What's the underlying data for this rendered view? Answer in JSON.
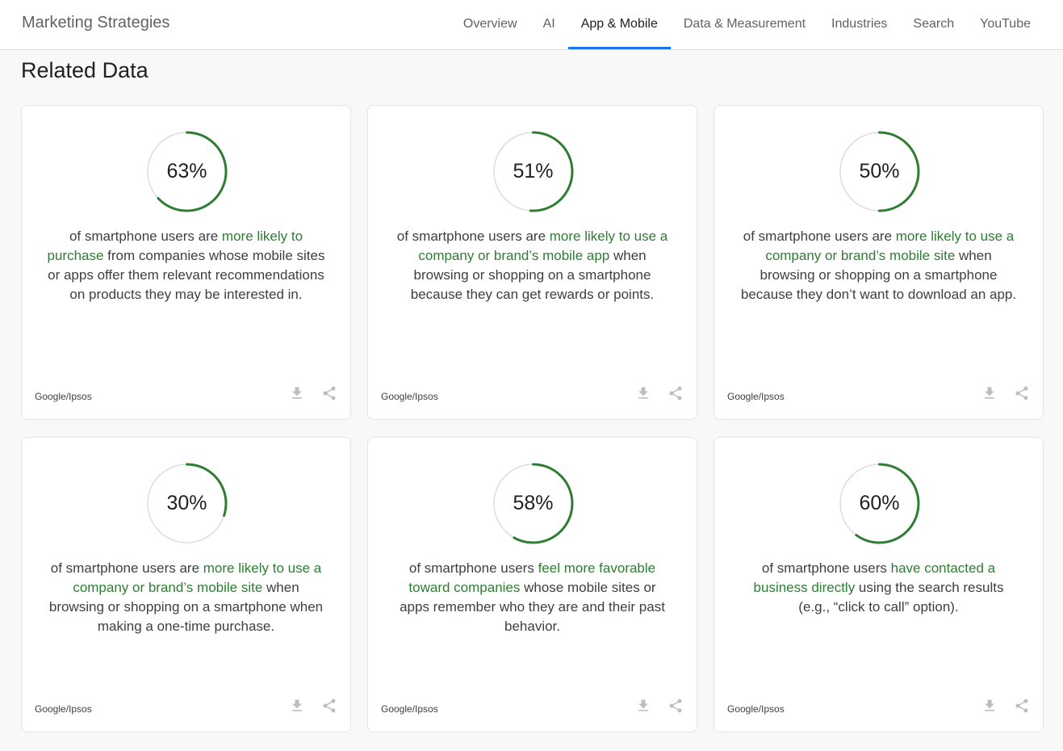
{
  "header": {
    "brand": "Marketing Strategies",
    "nav": [
      {
        "label": "Overview"
      },
      {
        "label": "AI"
      },
      {
        "label": "App & Mobile"
      },
      {
        "label": "Data & Measurement"
      },
      {
        "label": "Industries"
      },
      {
        "label": "Search"
      },
      {
        "label": "YouTube"
      }
    ],
    "active_index": 2
  },
  "section": {
    "title": "Related Data"
  },
  "colors": {
    "accent": "#2e7d32",
    "ring_track": "#dddddd",
    "nav_active": "#1a73e8"
  },
  "cards": [
    {
      "value_label": "63%",
      "fraction": 0.63,
      "text_before": "of smartphone users are ",
      "highlight": "more likely to purchase",
      "text_after": " from companies whose mobile sites or apps offer them relevant recommendations on products they may be interested in.",
      "source": "Google/Ipsos",
      "icons": [
        "download-icon",
        "share-icon"
      ]
    },
    {
      "value_label": "51%",
      "fraction": 0.51,
      "text_before": "of smartphone users are ",
      "highlight": "more likely to use a company or brand’s mobile app",
      "text_after": " when browsing or shopping on a smartphone because they can get rewards or points.",
      "source": "Google/Ipsos",
      "icons": [
        "download-icon",
        "share-icon"
      ]
    },
    {
      "value_label": "50%",
      "fraction": 0.5,
      "text_before": "of smartphone users are ",
      "highlight": "more likely to use a company or brand’s mobile site",
      "text_after": " when browsing or shopping on a smartphone because they don’t want to download an app.",
      "source": "Google/Ipsos",
      "icons": [
        "download-icon",
        "share-icon"
      ]
    },
    {
      "value_label": "30%",
      "fraction": 0.3,
      "text_before": "of smartphone users are ",
      "highlight": "more likely to use a company or brand’s mobile site",
      "text_after": " when browsing or shopping on a smartphone when making a one-time purchase.",
      "source": "Google/Ipsos",
      "icons": [
        "download-icon",
        "share-icon"
      ]
    },
    {
      "value_label": "58%",
      "fraction": 0.58,
      "text_before": "of smartphone users ",
      "highlight": "feel more favorable toward companies",
      "text_after": " whose mobile sites or apps remember who they are and their past behavior.",
      "source": "Google/Ipsos",
      "icons": [
        "download-icon",
        "share-icon"
      ]
    },
    {
      "value_label": "60%",
      "fraction": 0.6,
      "text_before": "of smartphone users ",
      "highlight": "have contacted a business directly",
      "text_after": " using the search results (e.g., “click to call” option).",
      "source": "Google/Ipsos",
      "icons": [
        "download-icon",
        "share-icon"
      ]
    }
  ]
}
